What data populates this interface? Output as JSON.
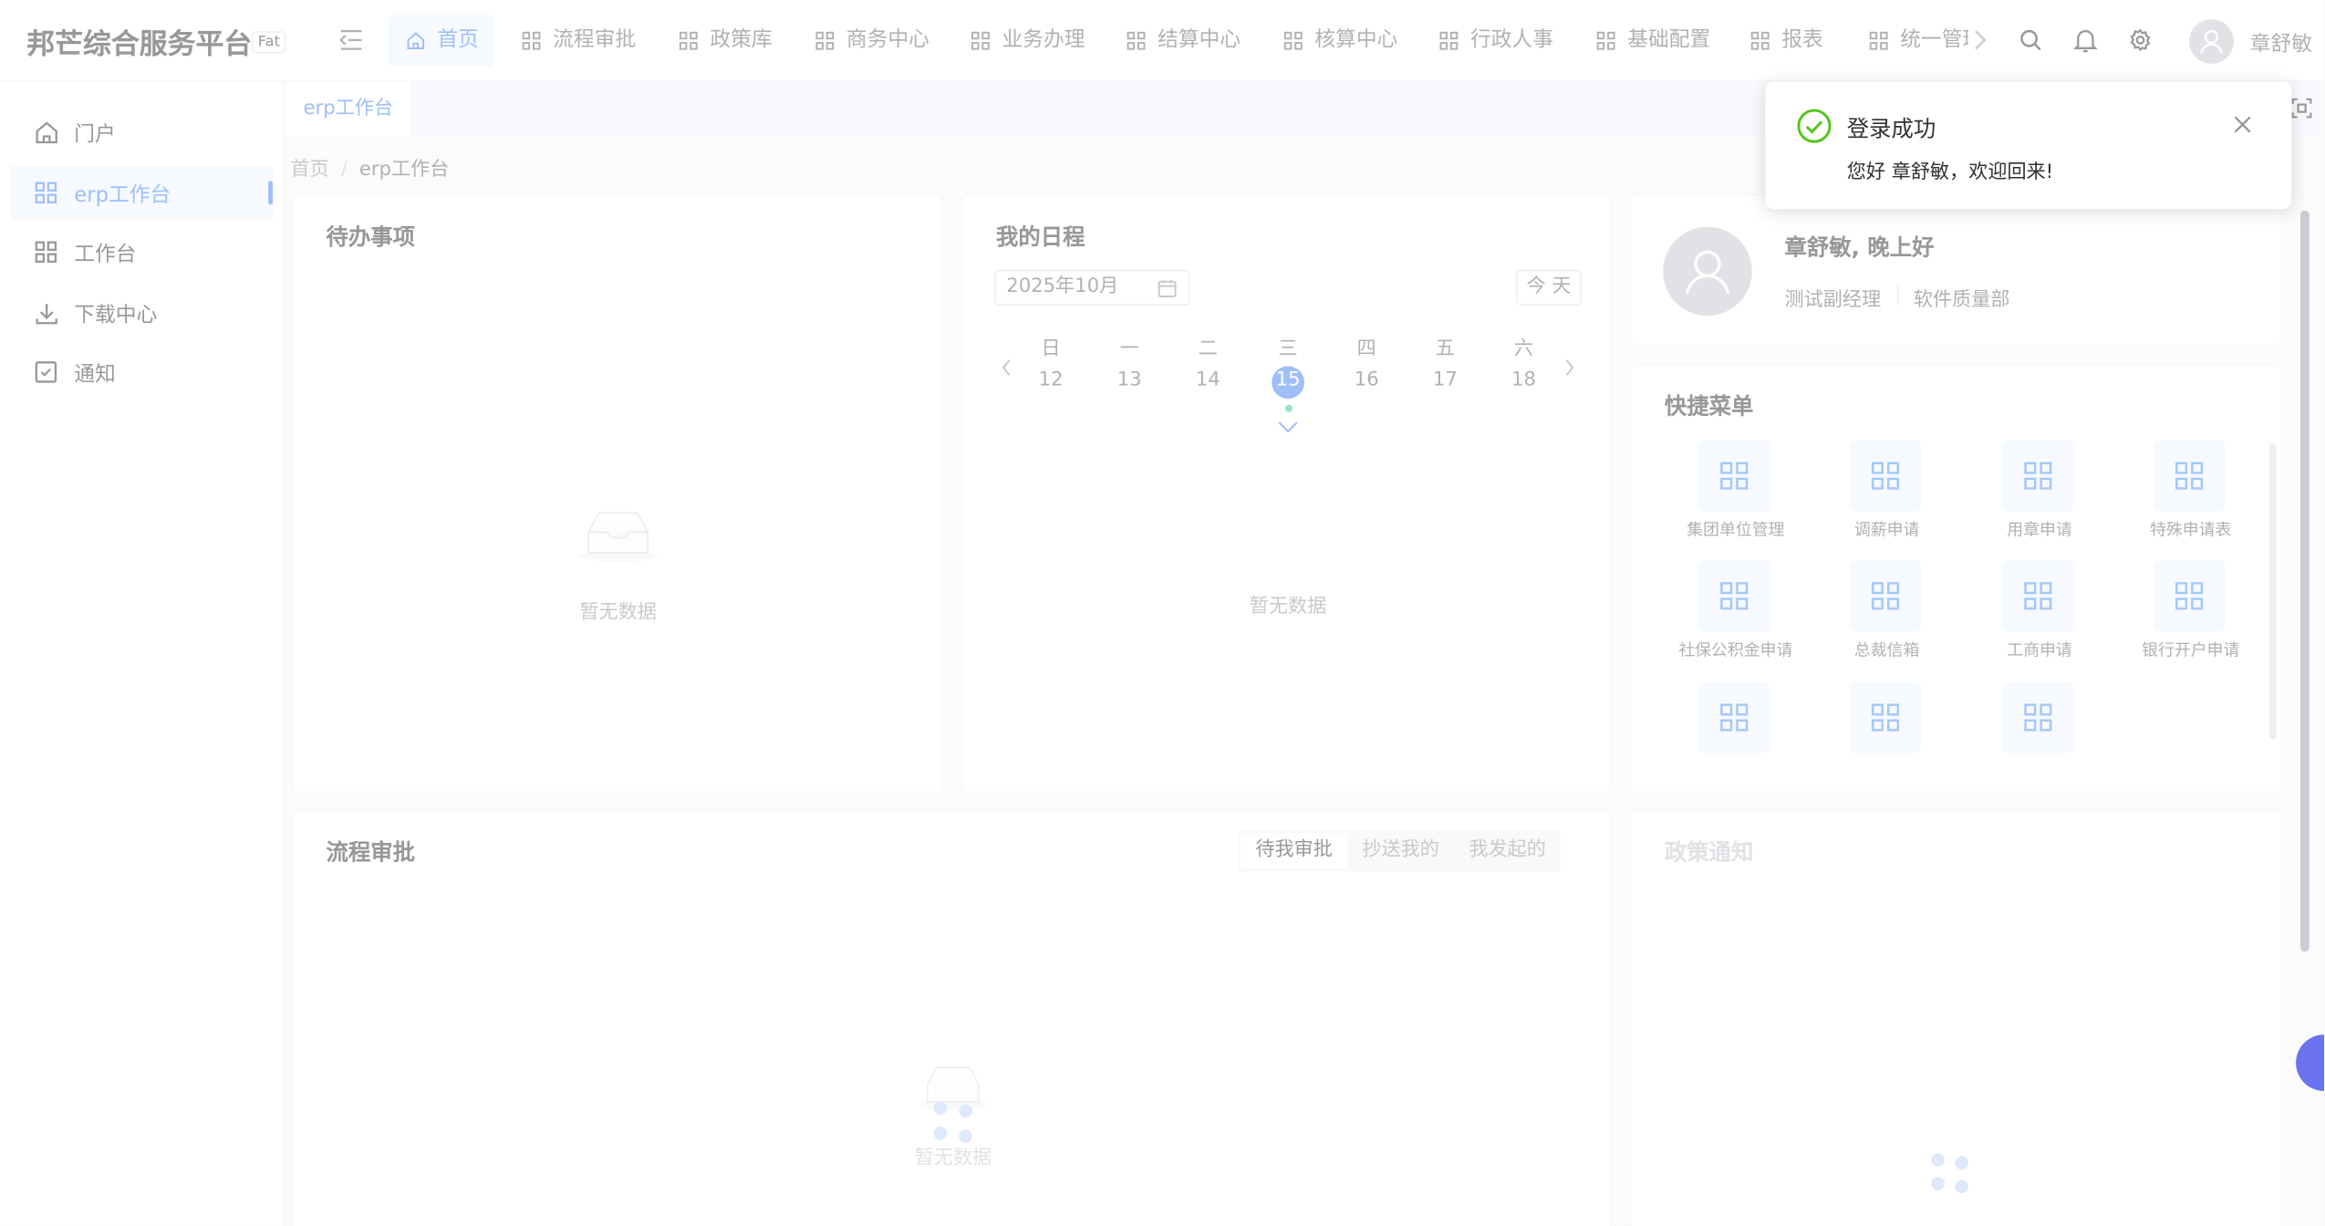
{
  "header": {
    "app_title": "邦芒综合服务平台",
    "env_badge": "Fat",
    "nav": [
      "首页",
      "流程审批",
      "政策库",
      "商务中心",
      "业务办理",
      "结算中心",
      "核算中心",
      "行政人事",
      "基础配置",
      "报表",
      "统一管理"
    ],
    "user_name": "章舒敏"
  },
  "sidebar": {
    "items": [
      {
        "label": "门户",
        "icon": "home-icon"
      },
      {
        "label": "erp工作台",
        "icon": "grid-icon",
        "active": true
      },
      {
        "label": "工作台",
        "icon": "grid-icon"
      },
      {
        "label": "下载中心",
        "icon": "download-icon"
      },
      {
        "label": "通知",
        "icon": "check-square-icon"
      }
    ]
  },
  "tabs": {
    "active": "erp工作台"
  },
  "breadcrumb": {
    "home": "首页",
    "separator": "/",
    "current": "erp工作台"
  },
  "todo": {
    "title": "待办事项",
    "empty": "暂无数据"
  },
  "schedule": {
    "title": "我的日程",
    "month": "2025年10月",
    "today_label": "今 天",
    "weekdays": [
      "日",
      "一",
      "二",
      "三",
      "四",
      "五",
      "六"
    ],
    "days": [
      "12",
      "13",
      "14",
      "15",
      "16",
      "17",
      "18"
    ],
    "selected_day": "15",
    "empty": "暂无数据"
  },
  "profile": {
    "greeting": "章舒敏, 晚上好",
    "position": "测试副经理",
    "department": "软件质量部"
  },
  "quick_menu": {
    "title": "快捷菜单",
    "items": [
      "集团单位管理",
      "调薪申请",
      "用章申请",
      "特殊申请表",
      "社保公积金申请",
      "总裁信箱",
      "工商申请",
      "银行开户申请",
      "",
      "",
      ""
    ]
  },
  "workflow": {
    "title": "流程审批",
    "tabs": [
      "待我审批",
      "抄送我的",
      "我发起的"
    ],
    "empty": "暂无数据"
  },
  "policy": {
    "title": "政策通知"
  },
  "notification": {
    "title": "登录成功",
    "message": "您好 章舒敏，欢迎回来!"
  },
  "colors": {
    "accent": "#3c7ef3",
    "success": "#2bc6a4",
    "ok_icon": "#52c41a"
  }
}
